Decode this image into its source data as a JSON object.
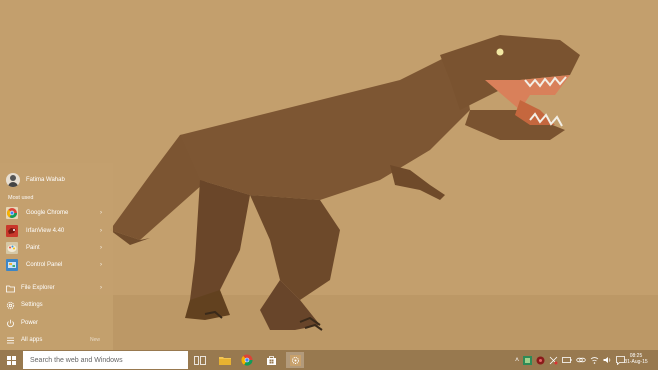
{
  "start_menu": {
    "user_name": "Fatima Wahab",
    "most_used_label": "Most used",
    "apps": [
      {
        "label": "Google Chrome",
        "icon": "chrome-icon"
      },
      {
        "label": "IrfanView 4.40",
        "icon": "irfanview-icon"
      },
      {
        "label": "Paint",
        "icon": "paint-icon"
      },
      {
        "label": "Control Panel",
        "icon": "control-panel-icon"
      }
    ],
    "system": [
      {
        "label": "File Explorer",
        "icon": "folder-icon"
      },
      {
        "label": "Settings",
        "icon": "gear-icon"
      },
      {
        "label": "Power",
        "icon": "power-icon"
      },
      {
        "label": "All apps",
        "icon": "list-icon",
        "badge": "New"
      }
    ]
  },
  "taskbar": {
    "search_placeholder": "Search the web and Windows",
    "pinned": [
      "task-view-icon",
      "file-explorer-icon",
      "chrome-icon",
      "store-icon",
      "settings-app-icon"
    ],
    "tray_icons": [
      "chevron-up-icon",
      "app-tray-icon",
      "tray-app-icon",
      "network-icon",
      "battery-icon",
      "link-icon",
      "wifi-icon",
      "volume-icon",
      "message-icon"
    ],
    "time": "08:25",
    "date": "31-Aug-15"
  },
  "colors": {
    "wallpaper": "#c39f6d",
    "taskbar": "#98794f",
    "dino": "#7a5430",
    "mouth": "#d9805a"
  }
}
